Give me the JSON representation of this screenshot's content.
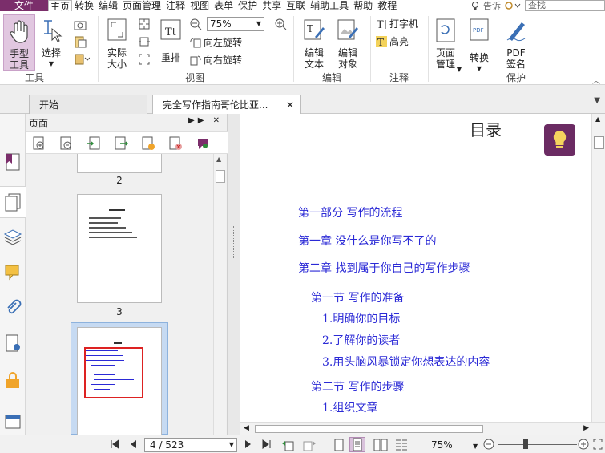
{
  "menu": {
    "file": "文件",
    "items": [
      "主页",
      "转换",
      "编辑",
      "页面管理",
      "注释",
      "视图",
      "表单",
      "保护",
      "共享",
      "互联",
      "辅助工具",
      "帮助",
      "教程"
    ],
    "tell_me": "告诉",
    "search_placeholder": "查找"
  },
  "ribbon": {
    "hand_tool": [
      "手型",
      "工具"
    ],
    "select": "选择",
    "group_tools": "工具",
    "actual_size": [
      "实际",
      "大小"
    ],
    "reflow": "重排",
    "zoom_value": "75%",
    "rotate_left": "向左旋转",
    "rotate_right": "向右旋转",
    "group_view": "视图",
    "edit_text": [
      "编辑",
      "文本"
    ],
    "edit_object": [
      "编辑",
      "对象"
    ],
    "group_edit": "编辑",
    "typewriter": "打字机",
    "highlight": "高亮",
    "group_annot": "注释",
    "page_manage": [
      "页面",
      "管理"
    ],
    "convert": "转换",
    "pdf_sign": [
      "PDF",
      "签名"
    ],
    "group_protect": "保护"
  },
  "tabs": {
    "home": "开始",
    "doc": "完全写作指南哥伦比亚..."
  },
  "panel": {
    "title": "页面",
    "pages": [
      "2",
      "3"
    ]
  },
  "document": {
    "title": "目录",
    "toc": [
      "第一部分 写作的流程",
      "第一章 没什么是你写不了的",
      "第二章 找到属于你自己的写作步骤",
      "第一节 写作的准备",
      "1.明确你的目标",
      "2.了解你的读者",
      "3.用头脑风暴锁定你想表达的内容",
      "第二节 写作的步骤",
      "1.组织文章"
    ]
  },
  "status": {
    "page_indicator": "4 / 523",
    "zoom": "75%"
  },
  "colors": {
    "brand": "#7b2e6b",
    "toc_link": "#2b2ad6",
    "selection": "#c6daf2"
  }
}
